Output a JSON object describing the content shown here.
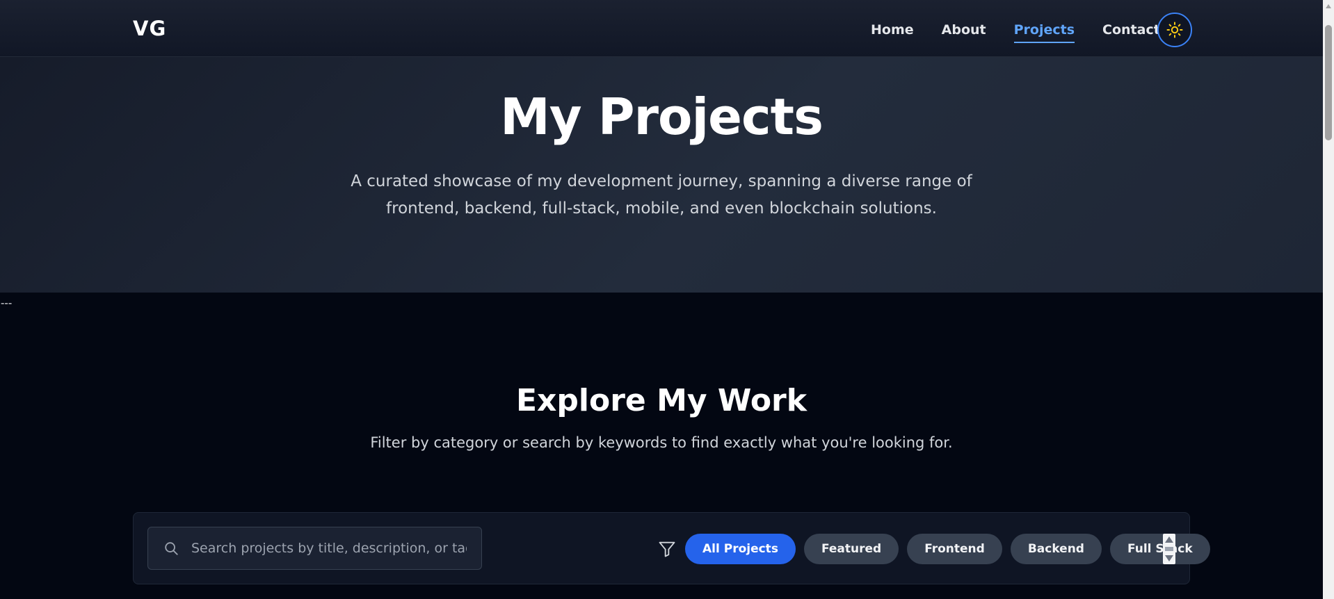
{
  "header": {
    "logo": "VG",
    "nav": [
      {
        "label": "Home",
        "active": false
      },
      {
        "label": "About",
        "active": false
      },
      {
        "label": "Projects",
        "active": true
      },
      {
        "label": "Contact",
        "active": false
      }
    ],
    "theme_toggle_icon": "sun-icon"
  },
  "hero": {
    "title": "My Projects",
    "description": "A curated showcase of my development journey, spanning a diverse range of frontend, backend, full-stack, mobile, and even blockchain solutions."
  },
  "separator": "---",
  "explore": {
    "title": "Explore My Work",
    "subtitle": "Filter by category or search by keywords to find exactly what you're looking for."
  },
  "filters": {
    "search_placeholder": "Search projects by title, description, or tag...",
    "search_value": "",
    "categories": [
      {
        "label": "All Projects",
        "active": true
      },
      {
        "label": "Featured",
        "active": false
      },
      {
        "label": "Frontend",
        "active": false
      },
      {
        "label": "Backend",
        "active": false
      },
      {
        "label": "Full Stack",
        "active": false
      }
    ]
  },
  "colors": {
    "accent": "#2563eb",
    "active_link": "#60a5fa",
    "sun": "#facc15",
    "background": "#030712"
  }
}
